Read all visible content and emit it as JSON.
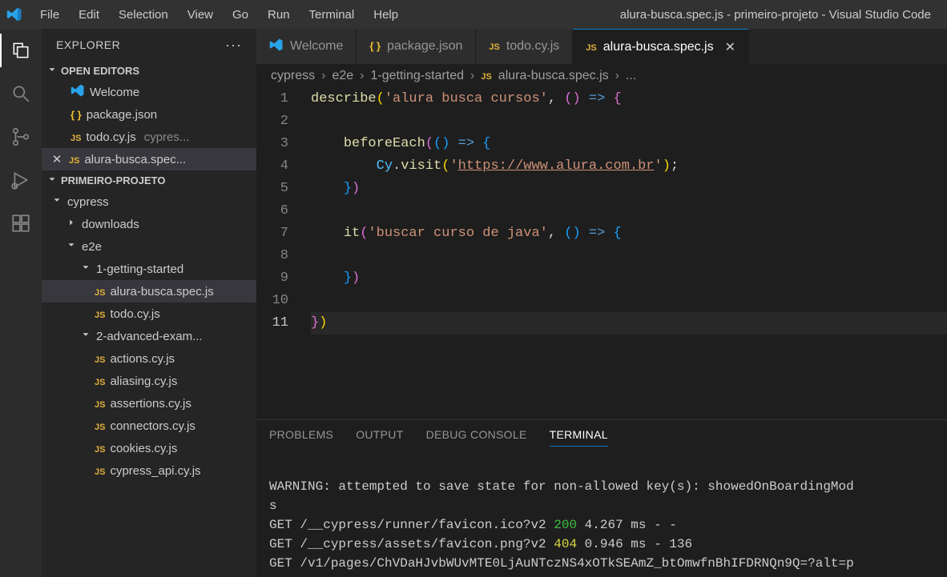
{
  "window": {
    "title": "alura-busca.spec.js - primeiro-projeto - Visual Studio Code"
  },
  "menu": [
    "File",
    "Edit",
    "Selection",
    "View",
    "Go",
    "Run",
    "Terminal",
    "Help"
  ],
  "sidebar": {
    "title": "EXPLORER",
    "open_editors_label": "OPEN EDITORS",
    "open_editors": [
      {
        "label": "Welcome",
        "icon": "vscode"
      },
      {
        "label": "package.json",
        "icon": "json"
      },
      {
        "label": "todo.cy.js",
        "icon": "js",
        "suffix": "cypres..."
      },
      {
        "label": "alura-busca.spec...",
        "icon": "js",
        "closable": true,
        "active": true
      }
    ],
    "project_label": "PRIMEIRO-PROJETO",
    "tree": [
      {
        "label": "cypress",
        "type": "folder",
        "open": true,
        "depth": 0
      },
      {
        "label": "downloads",
        "type": "folder",
        "open": false,
        "depth": 1
      },
      {
        "label": "e2e",
        "type": "folder",
        "open": true,
        "depth": 1
      },
      {
        "label": "1-getting-started",
        "type": "folder",
        "open": true,
        "depth": 2
      },
      {
        "label": "alura-busca.spec.js",
        "type": "js",
        "depth": 3,
        "active": true
      },
      {
        "label": "todo.cy.js",
        "type": "js",
        "depth": 3
      },
      {
        "label": "2-advanced-exam...",
        "type": "folder",
        "open": true,
        "depth": 2
      },
      {
        "label": "actions.cy.js",
        "type": "js",
        "depth": 3
      },
      {
        "label": "aliasing.cy.js",
        "type": "js",
        "depth": 3
      },
      {
        "label": "assertions.cy.js",
        "type": "js",
        "depth": 3
      },
      {
        "label": "connectors.cy.js",
        "type": "js",
        "depth": 3
      },
      {
        "label": "cookies.cy.js",
        "type": "js",
        "depth": 3
      },
      {
        "label": "cypress_api.cy.js",
        "type": "js",
        "depth": 3
      }
    ]
  },
  "tabs": [
    {
      "label": "Welcome",
      "icon": "vscode"
    },
    {
      "label": "package.json",
      "icon": "json"
    },
    {
      "label": "todo.cy.js",
      "icon": "js"
    },
    {
      "label": "alura-busca.spec.js",
      "icon": "js",
      "active": true,
      "closable": true
    }
  ],
  "breadcrumbs": [
    "cypress",
    "e2e",
    "1-getting-started",
    "alura-busca.spec.js",
    "..."
  ],
  "breadcrumbs_icon_index": 3,
  "code": {
    "current_line": 11,
    "lines": [
      "describe('alura busca cursos', () => {",
      "",
      "    beforeEach(() => {",
      "        Cy.visit('https://www.alura.com.br');",
      "    })",
      "",
      "    it('buscar curso de java', () => {",
      "        ",
      "    })",
      "",
      "})"
    ],
    "tokens": {
      "describe": "describe",
      "str1": "'alura busca cursos'",
      "beforeEach": "beforeEach",
      "Cy": "Cy",
      "visit": "visit",
      "url": "https://www.alura.com.br",
      "it": "it",
      "str2": "'buscar curso de java'"
    }
  },
  "panel": {
    "tabs": [
      "PROBLEMS",
      "OUTPUT",
      "DEBUG CONSOLE",
      "TERMINAL"
    ],
    "active_tab": "TERMINAL",
    "terminal": {
      "l1": "WARNING: attempted to save state for non-allowed key(s): showedOnBoardingMod",
      "l2": "s",
      "l3a": "GET /__cypress/runner/favicon.ico?v2 ",
      "l3status": "200",
      "l3b": " 4.267 ms - -",
      "l4a": "GET /__cypress/assets/favicon.png?v2 ",
      "l4status": "404",
      "l4b": " 0.946 ms - 136",
      "l5": "GET /v1/pages/ChVDaHJvbWUvMTE0LjAuNTczNS4xOTkSEAmZ_btOmwfnBhIFDRNQn9Q=?alt=p"
    }
  },
  "colors": {
    "accent": "#0d7bc2"
  }
}
